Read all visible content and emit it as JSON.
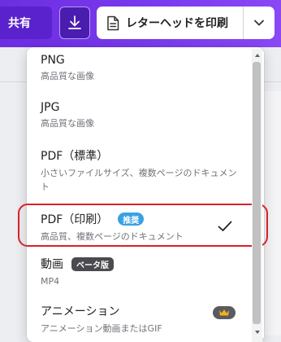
{
  "toolbar": {
    "share_label": "共有",
    "print_label": "レターヘッドを印刷"
  },
  "dropdown": {
    "options": [
      {
        "title": "PNG",
        "subtitle": "高品質な画像"
      },
      {
        "title": "JPG",
        "subtitle": "高品質な画像"
      },
      {
        "title": "PDF（標準）",
        "subtitle": "小さいファイルサイズ、複数ページのドキュメント"
      },
      {
        "title": "PDF（印刷）",
        "badge": "推奨",
        "subtitle": "高品質、複数ページのドキュメント",
        "selected": true
      },
      {
        "title": "動画",
        "badge": "ベータ版",
        "subtitle": "MP4"
      },
      {
        "title": "アニメーション",
        "subtitle": "アニメーション動画またはGIF",
        "premium": true
      }
    ]
  },
  "colors": {
    "accent": "#7b3cf0",
    "highlight": "#d8232a",
    "recommended_badge": "#3aa0e3",
    "beta_badge": "#4a4a4f"
  }
}
